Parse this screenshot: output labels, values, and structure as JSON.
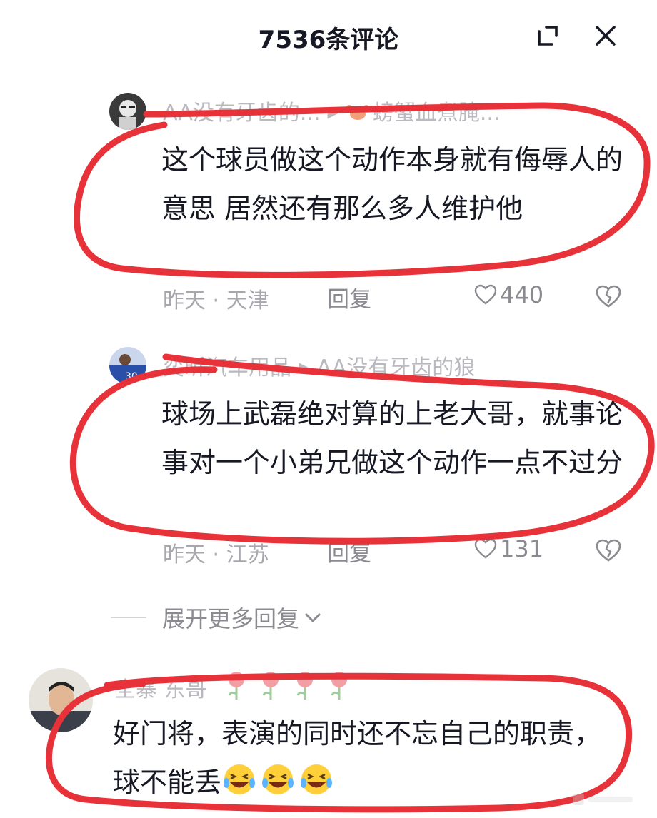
{
  "header": {
    "title": "7536条评论",
    "expand_icon": "expand-icon",
    "close_icon": "close-icon"
  },
  "comments": [
    {
      "author": "AA没有牙齿的...",
      "reply_to": "螃蟹血煮腌...",
      "reply_to_emoji": "crab",
      "text": "这个球员做这个动作本身就有侮辱人的意思 居然还有那么多人维护他",
      "meta": "昨天 · 天津",
      "reply_label": "回复",
      "likes": "440"
    },
    {
      "author": "奕昕汽车用品",
      "reply_to": "AA没有牙齿的狼",
      "text": "球场上武磊绝对算的上老大哥，就事论事对一个小弟兄做这个动作一点不过分",
      "meta": "昨天 · 江苏",
      "reply_label": "回复",
      "likes": "131"
    },
    {
      "author": "全寨 东哥",
      "author_emojis": [
        "rose",
        "rose",
        "rose",
        "rose"
      ],
      "text": "好门将，表演的同时还不忘自己的职责，球不能丢",
      "text_emojis": [
        "laughing-crying",
        "laughing-crying",
        "laughing-crying"
      ]
    }
  ],
  "expand_more": {
    "label": "展开更多回复"
  },
  "colors": {
    "annotation": "#e8323a",
    "secondary_text": "#a7a7ad",
    "primary_text": "#161823"
  }
}
